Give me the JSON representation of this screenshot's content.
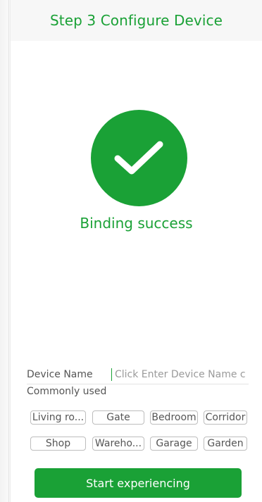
{
  "header": {
    "title": "Step 3 Configure Device"
  },
  "status": {
    "icon": "check-icon",
    "message": "Binding success"
  },
  "form": {
    "device_name_label": "Device Name",
    "device_name_value": "",
    "device_name_placeholder": "Click Enter Device Name c",
    "commonly_used_label": "Commonly used",
    "presets": [
      "Living ro...",
      "Gate",
      "Bedroom",
      "Corridor",
      "Shop",
      "Wareho...",
      "Garage",
      "Garden"
    ]
  },
  "actions": {
    "start_label": "Start experiencing"
  },
  "colors": {
    "accent": "#1aa136",
    "header_bg": "#f7f7f7",
    "chip_border": "#bdbdbd",
    "muted_text": "#555555",
    "placeholder_text": "#9a9a9a"
  }
}
